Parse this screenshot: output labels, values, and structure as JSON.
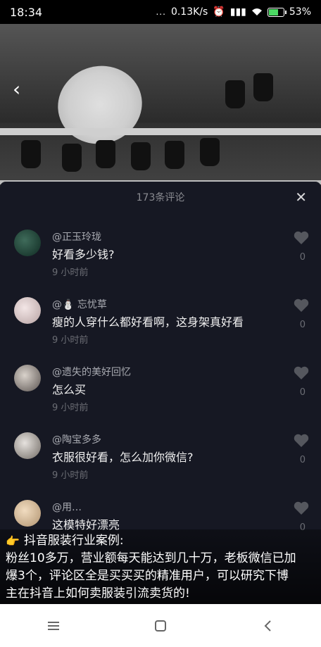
{
  "status": {
    "time": "18:34",
    "dots": "...",
    "network_speed": "0.13K/s",
    "battery": "53%"
  },
  "comments_panel": {
    "title": "173条评论",
    "close_icon": "close-icon",
    "comments": [
      {
        "user": "@正玉玲珑",
        "text": "好看多少钱?",
        "time": "9 小时前",
        "likes": "0"
      },
      {
        "user": "@⛄ 忘忧草",
        "text": "瘦的人穿什么都好看啊，这身架真好看",
        "time": "9 小时前",
        "likes": "0"
      },
      {
        "user": "@遗失的美好回忆",
        "text": "怎么买",
        "time": "9 小时前",
        "likes": "0"
      },
      {
        "user": "@陶宝多多",
        "text": "衣服很好看，怎么加你微信?",
        "time": "9 小时前",
        "likes": "0"
      },
      {
        "user": "@用…",
        "text": "这模特好漂亮",
        "time": "",
        "likes": "0"
      }
    ]
  },
  "caption": {
    "title": "抖音服装行业案例:",
    "line1": "粉丝10多万，营业额每天能达到几十万，老板微信已加",
    "line2": "爆3个，评论区全是买买买的精准用户，可以研究下博",
    "line3": "主在抖音上如何卖服装引流卖货的!"
  },
  "colors": {
    "panel_bg": "#161823",
    "muted_text": "#6b6d74",
    "username_text": "#a9abb2"
  }
}
